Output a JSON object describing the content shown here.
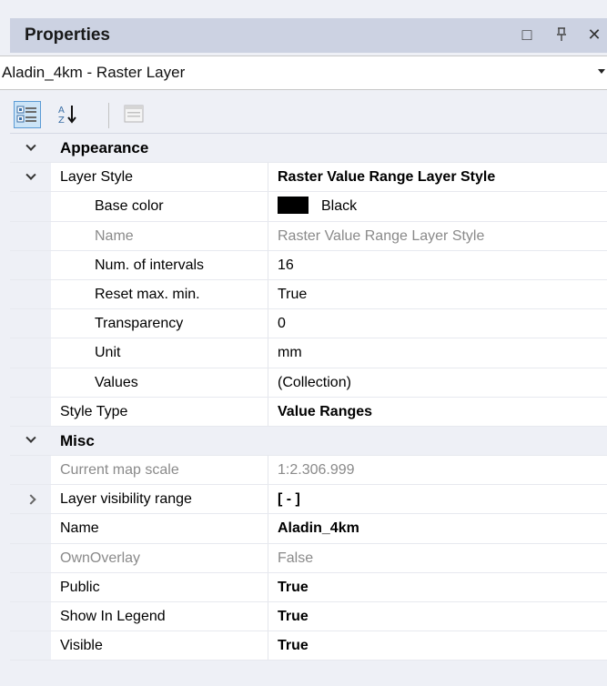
{
  "panel": {
    "title": "Properties",
    "maximize_glyph": "□",
    "pin_glyph": "⊥",
    "close_glyph": "✕"
  },
  "object_selector": {
    "value": "Aladin_4km - Raster Layer"
  },
  "toolbar": {
    "categorized_icon": "categorized-icon",
    "alphabetical_icon": "alphabetical-icon",
    "property_pages_icon": "property-pages-icon"
  },
  "categories": {
    "appearance": "Appearance",
    "misc": "Misc"
  },
  "rows": {
    "layer_style": {
      "name": "Layer Style",
      "value": "Raster Value Range Layer Style"
    },
    "base_color": {
      "name": "Base color",
      "value": "Black",
      "color": "#000000"
    },
    "style_name": {
      "name": "Name",
      "value": "Raster Value Range Layer Style"
    },
    "num_intervals": {
      "name": "Num. of intervals",
      "value": "16"
    },
    "reset_max_min": {
      "name": "Reset max. min.",
      "value": "True"
    },
    "transparency": {
      "name": "Transparency",
      "value": "0"
    },
    "unit": {
      "name": "Unit",
      "value": "mm"
    },
    "values": {
      "name": "Values",
      "value": "(Collection)"
    },
    "style_type": {
      "name": "Style Type",
      "value": "Value Ranges"
    },
    "current_map_scale": {
      "name": "Current map scale",
      "value": "1:2.306.999"
    },
    "layer_visibility_range": {
      "name": "Layer visibility range",
      "value": "[ - ]"
    },
    "name": {
      "name": "Name",
      "value": "Aladin_4km"
    },
    "own_overlay": {
      "name": "OwnOverlay",
      "value": "False"
    },
    "public": {
      "name": "Public",
      "value": "True"
    },
    "show_in_legend": {
      "name": "Show In Legend",
      "value": "True"
    },
    "visible": {
      "name": "Visible",
      "value": "True"
    }
  },
  "colors": {
    "title_bar": "#ccd2e2",
    "panel_bg": "#eef0f6",
    "selected_button": "#cce4f7",
    "disabled_text": "#8a8a8a"
  }
}
